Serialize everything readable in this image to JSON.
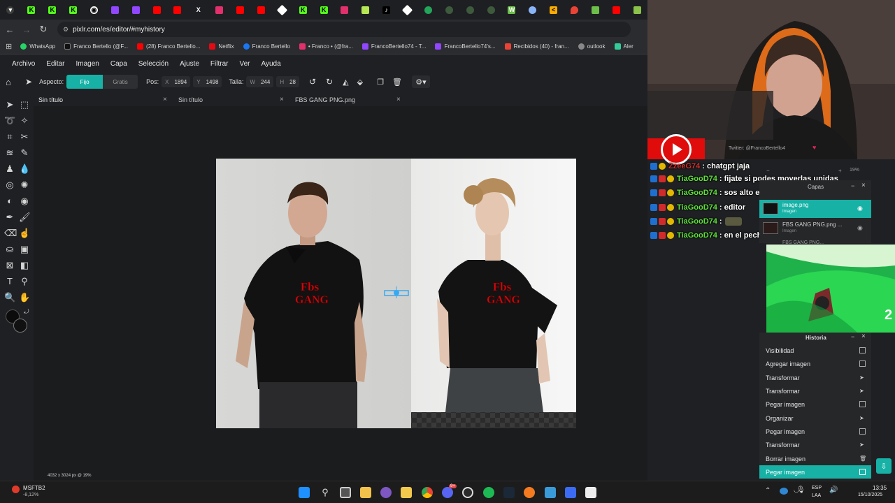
{
  "browser": {
    "url": "pixlr.com/es/editor/#myhistory",
    "bookmarks": [
      {
        "label": "WhatsApp",
        "color": "#25d366"
      },
      {
        "label": "Franco Bertello (@F...",
        "color": "#111111"
      },
      {
        "label": "(28) Franco Bertello...",
        "color": "#ff0000"
      },
      {
        "label": "Netflix",
        "color": "#e50914"
      },
      {
        "label": "Franco Bertello",
        "color": "#1877f2"
      },
      {
        "label": "• Franco • (@fra...",
        "color": "#e1306c"
      },
      {
        "label": "FrancoBertello74 - T...",
        "color": "#9146ff"
      },
      {
        "label": "FrancoBertello74's...",
        "color": "#9146ff"
      },
      {
        "label": "Recibidos (40) - fran...",
        "color": "#ea4335"
      },
      {
        "label": "outlook",
        "color": "#888888"
      },
      {
        "label": "Aler",
        "color": "#33cc99"
      }
    ]
  },
  "editor": {
    "menu": [
      "Archivo",
      "Editar",
      "Imagen",
      "Capa",
      "Selección",
      "Ajuste",
      "Filtrar",
      "Ver",
      "Ayuda"
    ],
    "options": {
      "aspect_label": "Aspecto:",
      "fixed": "Fijo",
      "free": "Gratis",
      "pos_label": "Pos:",
      "x_label": "X",
      "x_value": "1894",
      "y_label": "Y",
      "y_value": "1498",
      "size_label": "Talla:",
      "w_label": "W",
      "w_value": "244",
      "h_label": "H",
      "h_value": "28"
    },
    "doc_tabs": [
      "Sin título",
      "Sin título",
      "FBS GANG PNG.png"
    ],
    "shirt_text_1": "Fbs",
    "shirt_text_2": "GANG",
    "status": "4032 x 3024 px @ 19%"
  },
  "chat": {
    "partial_user": "ZzeeG74",
    "partial_msg": ": chatgpt jaja",
    "messages": [
      {
        "user": "TiaGooD74",
        "text": ": fijate si podes moverlas unidas"
      },
      {
        "user": "TiaGooD74",
        "text": ": sos alto editos"
      },
      {
        "user": "TiaGooD74",
        "text": ": editor"
      },
      {
        "user": "TiaGooD74",
        "text": ":"
      },
      {
        "user": "TiaGooD74",
        "text": ": en el pecho queda raro"
      }
    ]
  },
  "overlay": {
    "twitter": "Twitter: @FrancoBertello4",
    "zoom": "19%"
  },
  "layers": {
    "title": "Capas",
    "items": [
      {
        "name": "image.png",
        "sub": "Imagen"
      },
      {
        "name": "FBS GANG PNG.png ...",
        "sub": "Imagen"
      }
    ],
    "partial": "FBS GANG PNG..."
  },
  "history": {
    "title": "Historia",
    "items": [
      "Visibilidad",
      "Agregar imagen",
      "Transformar",
      "Transformar",
      "Pegar imagen",
      "Organizar",
      "Pegar imagen",
      "Transformar",
      "Borrar imagen",
      "Pegar imagen"
    ]
  },
  "game": {
    "text": "2"
  },
  "taskbar": {
    "stock_name": "MSFTB2",
    "stock_change": "-8,12%",
    "lang": "ESP",
    "layout": "LAA",
    "time": "13:35",
    "date": "15/10/2025",
    "badge_count": "9+"
  }
}
